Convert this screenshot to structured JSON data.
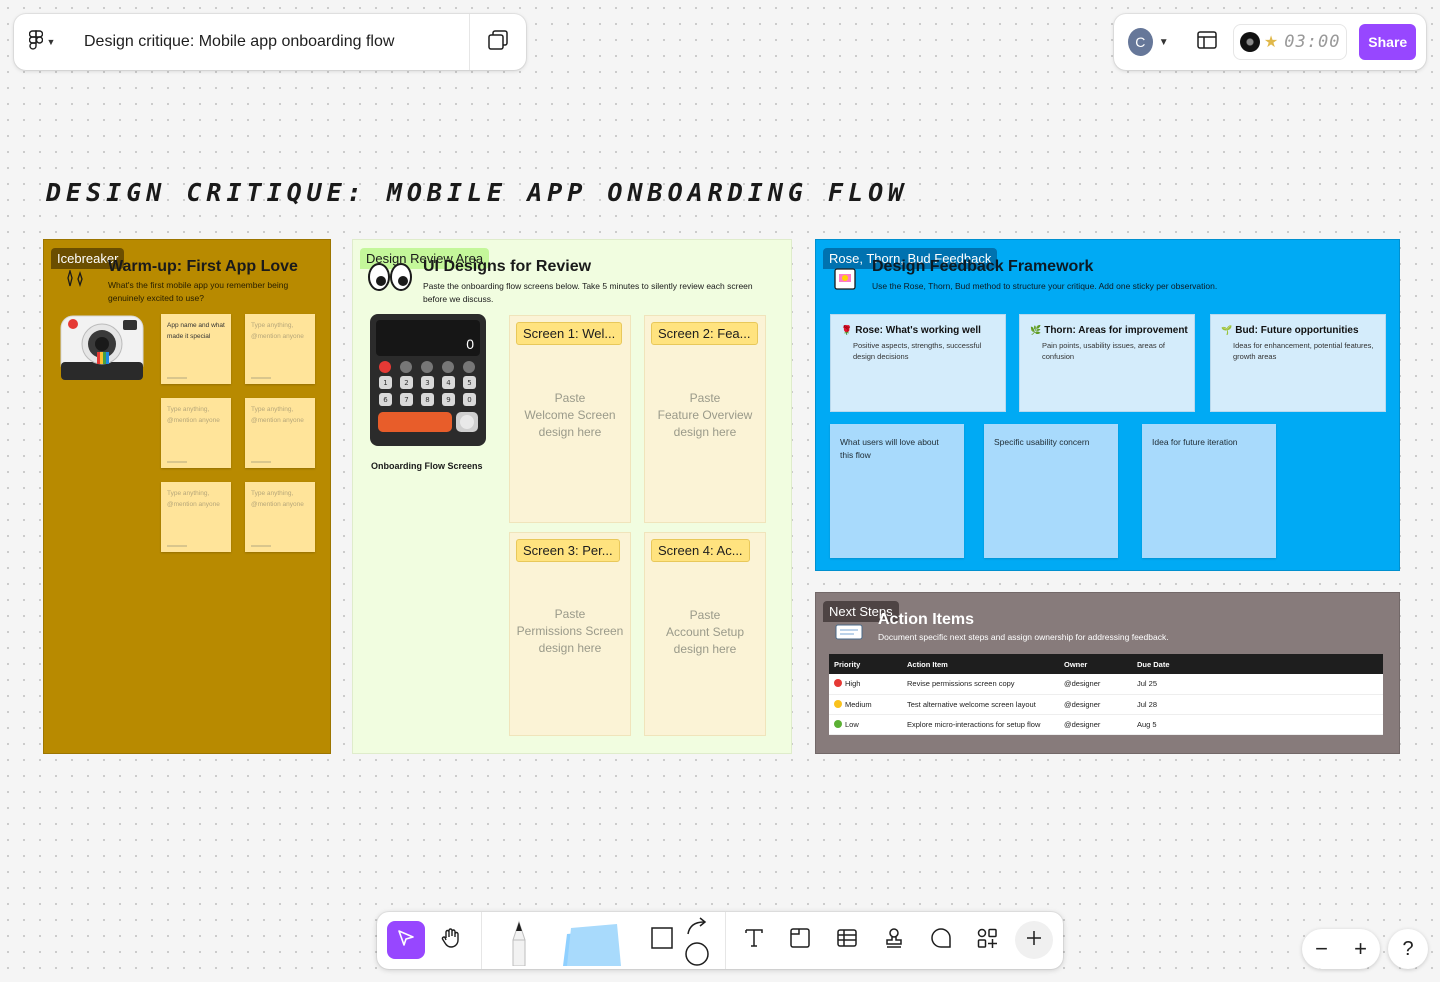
{
  "header": {
    "doc_title": "Design critique: Mobile app onboarding flow",
    "avatar_initial": "C",
    "timer": "03:00",
    "share_label": "Share"
  },
  "board_title": "DESIGN CRITIQUE: MOBILE APP ONBOARDING FLOW",
  "icebreaker": {
    "label": "Icebreaker",
    "heading": "Warm-up: First App Love",
    "subtitle": "What's the first mobile app you remember being genuinely excited to use?",
    "stickies": [
      "App name and what made it special",
      "Type anything, @mention anyone",
      "Type anything, @mention anyone",
      "Type anything, @mention anyone",
      "Type anything, @mention anyone",
      "Type anything, @mention anyone"
    ]
  },
  "review": {
    "label": "Design Review Area",
    "heading": "UI Designs for Review",
    "subtitle": "Paste the onboarding flow screens below. Take 5 minutes to silently review each screen before we discuss.",
    "calculator_display": "0",
    "caption": "Onboarding Flow Screens",
    "cards": [
      {
        "tag": "Screen 1: Wel...",
        "line1": "Paste",
        "line2": "Welcome Screen",
        "line3": "design here"
      },
      {
        "tag": "Screen 2: Fea...",
        "line1": "Paste",
        "line2": "Feature Overview",
        "line3": "design here"
      },
      {
        "tag": "Screen 3: Per...",
        "line1": "Paste",
        "line2": "Permissions Screen",
        "line3": "design here"
      },
      {
        "tag": "Screen 4: Ac...",
        "line1": "Paste",
        "line2": "Account Setup",
        "line3": "design here"
      }
    ]
  },
  "feedback": {
    "label": "Rose, Thorn, Bud Feedback",
    "heading": "Design Feedback Framework",
    "subtitle": "Use the Rose, Thorn, Bud method to structure your critique. Add one sticky per observation.",
    "categories": [
      {
        "icon": "🌹",
        "title": "Rose: What's working well",
        "desc": "Positive aspects, strengths, successful design decisions"
      },
      {
        "icon": "🌿",
        "title": "Thorn: Areas for improvement",
        "desc": "Pain points, usability issues, areas of confusion"
      },
      {
        "icon": "🌱",
        "title": "Bud: Future opportunities",
        "desc": "Ideas for enhancement, potential features, growth areas"
      }
    ],
    "stickies": [
      "What users will love about this flow",
      "Specific usability concern",
      "Idea for future iteration"
    ]
  },
  "next_steps": {
    "label": "Next Steps",
    "heading": "Action Items",
    "subtitle": "Document specific next steps and assign ownership for addressing feedback.",
    "columns": [
      "Priority",
      "Action Item",
      "Owner",
      "Due Date"
    ],
    "rows": [
      {
        "priority": "High",
        "color": "#e53935",
        "action": "Revise permissions screen copy",
        "owner": "@designer",
        "due": "Jul 25"
      },
      {
        "priority": "Medium",
        "color": "#f9c21d",
        "action": "Test alternative welcome screen layout",
        "owner": "@designer",
        "due": "Jul 28"
      },
      {
        "priority": "Low",
        "color": "#5bb033",
        "action": "Explore micro-interactions for setup flow",
        "owner": "@designer",
        "due": "Aug 5"
      }
    ]
  },
  "colors": {
    "icebreaker_bg": "#b88a00",
    "review_bg": "#f1fde0",
    "feedback_bg": "#00aaf4",
    "next_steps_bg": "#877b7b",
    "accent": "#9747ff"
  }
}
